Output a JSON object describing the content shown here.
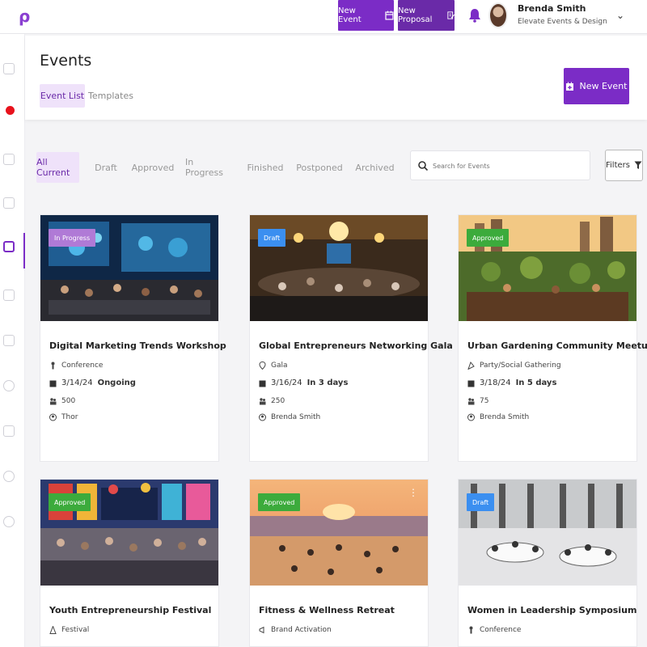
{
  "top_bar": {
    "logo": "ρ",
    "new_event_label": "New Event",
    "new_proposal_label": "New Proposal",
    "user_name": "Brenda Smith",
    "user_org": "Elevate Events & Design",
    "chevron": "⌄"
  },
  "colors": {
    "brand": "#7b2cc6",
    "in_progress": "#b07ad6",
    "draft": "#3b8ff0",
    "approved": "#3cab3c",
    "notification": "#e8121c"
  },
  "page": {
    "title": "Events",
    "tabs": [
      "Event List",
      "Templates"
    ],
    "new_event_label": "New Event"
  },
  "filters": {
    "tabs": [
      "All Current",
      "Draft",
      "Approved",
      "In Progress",
      "Finished",
      "Postponed",
      "Archived"
    ],
    "search_placeholder": "Search for Events",
    "filters_label": "Filters"
  },
  "events": [
    {
      "status": "In Progress",
      "title": "Digital Marketing Trends Workshop",
      "type": "Conference",
      "date": "3/14/24",
      "relative": "Ongoing",
      "guests": "500",
      "owner": "Thor"
    },
    {
      "status": "Draft",
      "title": "Global Entrepreneurs Networking Gala",
      "type": "Gala",
      "date": "3/16/24",
      "relative": "In 3 days",
      "guests": "250",
      "owner": "Brenda Smith"
    },
    {
      "status": "Approved",
      "title": "Urban Gardening Community Meetup",
      "type": "Party/Social Gathering",
      "date": "3/18/24",
      "relative": "In 5 days",
      "guests": "75",
      "owner": "Brenda Smith"
    },
    {
      "status": "Approved",
      "title": "Youth Entrepreneurship Festival",
      "type": "Festival",
      "date": "",
      "relative": "",
      "guests": "",
      "owner": ""
    },
    {
      "status": "Approved",
      "title": "Fitness & Wellness Retreat",
      "type": "Brand Activation",
      "date": "",
      "relative": "",
      "guests": "",
      "owner": ""
    },
    {
      "status": "Draft",
      "title": "Women in Leadership Symposium",
      "type": "Conference",
      "date": "",
      "relative": "",
      "guests": "",
      "owner": ""
    }
  ]
}
